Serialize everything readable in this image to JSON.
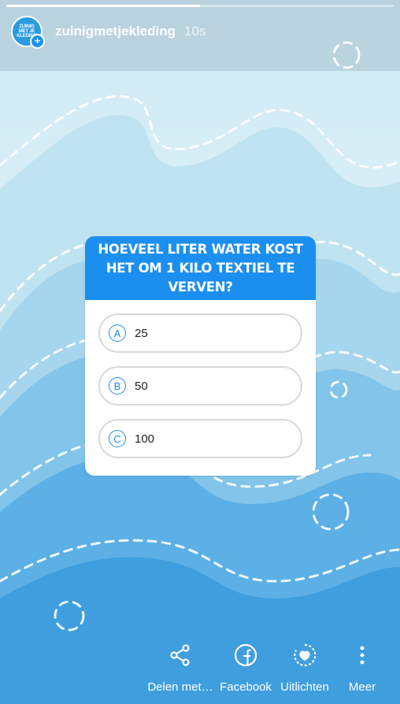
{
  "story": {
    "progress": 0.5,
    "username": "zuinigmetjekleding",
    "time": "10s",
    "avatar": {
      "logo_text": [
        "ZUINIG",
        "MET JE",
        "KLEDING"
      ],
      "badge_icon": "plus-icon"
    }
  },
  "quiz": {
    "question": "Hoeveel liter water kost het om 1 kilo textiel te verven?",
    "accent_color": "#1b8ff0",
    "options": [
      {
        "letter": "A",
        "label": "25"
      },
      {
        "letter": "B",
        "label": "50"
      },
      {
        "letter": "C",
        "label": "100"
      }
    ]
  },
  "actions": [
    {
      "label": "Delen met…",
      "icon": "share-icon"
    },
    {
      "label": "Facebook",
      "icon": "facebook-icon"
    },
    {
      "label": "Uitlichten",
      "icon": "highlight-heart-icon"
    },
    {
      "label": "Meer",
      "icon": "more-vertical-icon"
    }
  ],
  "colors": {
    "sky_top": "#d7eef6",
    "wave_light": "#bfe3f0",
    "wave_mid": "#7ec6e8",
    "wave_deep": "#3f9ede"
  }
}
